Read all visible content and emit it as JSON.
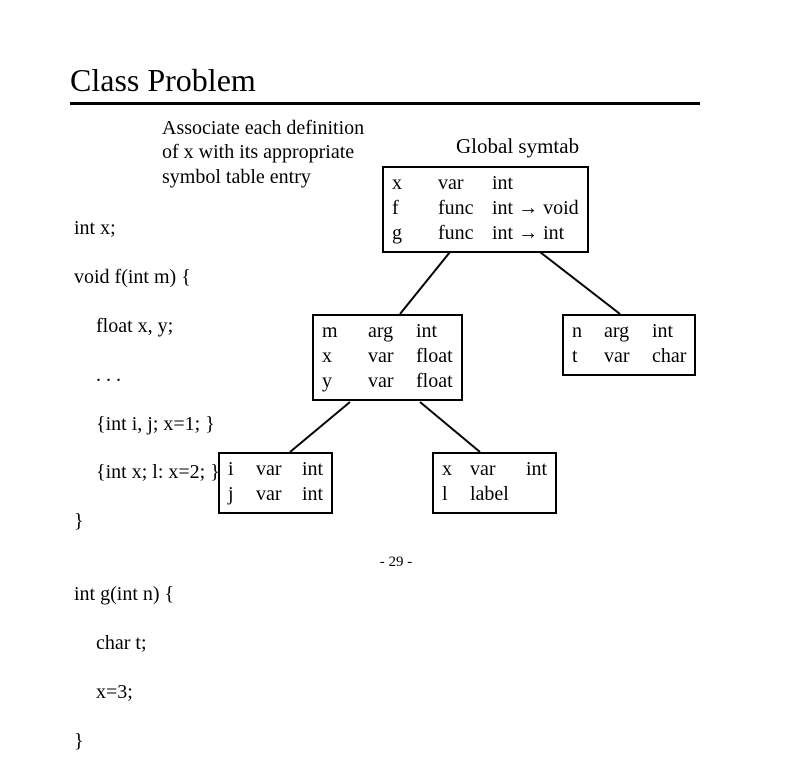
{
  "title": "Class Problem",
  "instruction": "Associate each definition of x with its appropriate symbol table entry",
  "code": {
    "l1": "int x;",
    "l2": "void f(int m) {",
    "l3": "float x, y;",
    "l4": ". . .",
    "l5": "{int i, j; x=1; }",
    "l6": "{int x; l: x=2; }",
    "l7": "}",
    "l8": "",
    "l9": "int g(int n) {",
    "l10": "char t;",
    "l11": "x=3;",
    "l12": "}"
  },
  "global_label": "Global symtab",
  "tables": {
    "global": [
      {
        "name": "x",
        "kind": "var",
        "type": "int"
      },
      {
        "name": "f",
        "kind": "func",
        "type": "int → void"
      },
      {
        "name": "g",
        "kind": "func",
        "type": "int → int"
      }
    ],
    "f": [
      {
        "name": "m",
        "kind": "arg",
        "type": "int"
      },
      {
        "name": "x",
        "kind": "var",
        "type": "float"
      },
      {
        "name": "y",
        "kind": "var",
        "type": "float"
      }
    ],
    "g": [
      {
        "name": "n",
        "kind": "arg",
        "type": "int"
      },
      {
        "name": "t",
        "kind": "var",
        "type": "char"
      }
    ],
    "ij": [
      {
        "name": "i",
        "kind": "var",
        "type": "int"
      },
      {
        "name": "j",
        "kind": "var",
        "type": "int"
      }
    ],
    "xl": [
      {
        "name": "x",
        "kind": "var",
        "type": "int"
      },
      {
        "name": "l",
        "kind": "label",
        "type": ""
      }
    ]
  },
  "page_number": "- 29 -"
}
